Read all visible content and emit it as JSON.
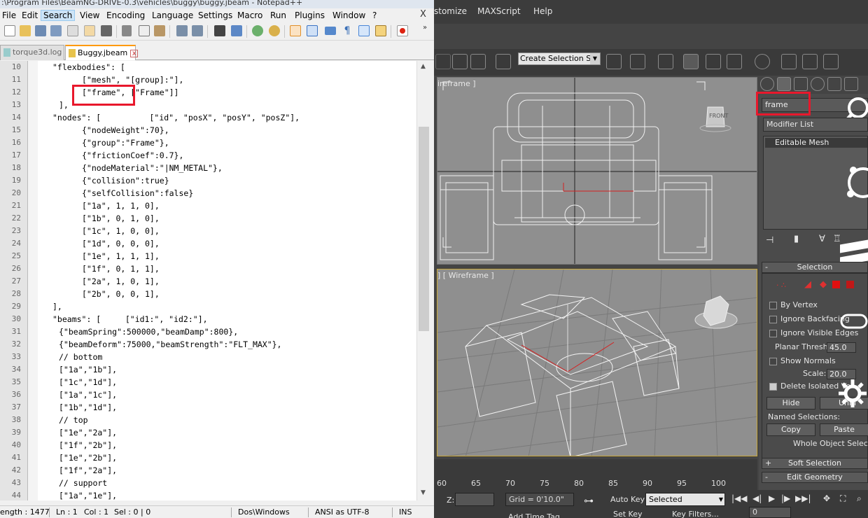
{
  "npp": {
    "title": ":\\Program Files\\BeamNG-DRIVE-0.3\\vehicles\\buggy\\buggy.jbeam - Notepad++",
    "menu": [
      "File",
      "Edit",
      "Search",
      "View",
      "Encoding",
      "Language",
      "Settings",
      "Macro",
      "Run",
      "Plugins",
      "Window",
      "?"
    ],
    "close_label": "X",
    "tabs": [
      {
        "label": "torque3d.log"
      },
      {
        "label": "Buggy.jbeam"
      }
    ],
    "lines": [
      {
        "n": "10",
        "text": "\"flexbodies\": ["
      },
      {
        "n": "11",
        "text": "[\"mesh\", \"[group]:\"],"
      },
      {
        "n": "12",
        "text": "[\"frame\", [\"Frame\"]]"
      },
      {
        "n": "13",
        "text": "],"
      },
      {
        "n": "14",
        "text": "\"nodes\": [          [\"id\", \"posX\", \"posY\", \"posZ\"],"
      },
      {
        "n": "15",
        "text": "{\"nodeWeight\":70},"
      },
      {
        "n": "16",
        "text": "{\"group\":\"Frame\"},"
      },
      {
        "n": "17",
        "text": "{\"frictionCoef\":0.7},"
      },
      {
        "n": "18",
        "text": "{\"nodeMaterial\":\"|NM_METAL\"},"
      },
      {
        "n": "19",
        "text": "{\"collision\":true}"
      },
      {
        "n": "20",
        "text": "{\"selfCollision\":false}"
      },
      {
        "n": "21",
        "text": "[\"1a\", 1, 1, 0],"
      },
      {
        "n": "22",
        "text": "[\"1b\", 0, 1, 0],"
      },
      {
        "n": "23",
        "text": "[\"1c\", 1, 0, 0],"
      },
      {
        "n": "24",
        "text": "[\"1d\", 0, 0, 0],"
      },
      {
        "n": "25",
        "text": "[\"1e\", 1, 1, 1],"
      },
      {
        "n": "26",
        "text": "[\"1f\", 0, 1, 1],"
      },
      {
        "n": "27",
        "text": "[\"2a\", 1, 0, 1],"
      },
      {
        "n": "28",
        "text": "[\"2b\", 0, 0, 1],"
      },
      {
        "n": "29",
        "text": "],"
      },
      {
        "n": "30",
        "text": "\"beams\": [     [\"id1:\", \"id2:\"],"
      },
      {
        "n": "31",
        "text": "{\"beamSpring\":500000,\"beamDamp\":800},"
      },
      {
        "n": "32",
        "text": "{\"beamDeform\":75000,\"beamStrength\":\"FLT_MAX\"},"
      },
      {
        "n": "33",
        "text": "// bottom"
      },
      {
        "n": "34",
        "text": "[\"1a\",\"1b\"],"
      },
      {
        "n": "35",
        "text": "[\"1c\",\"1d\"],"
      },
      {
        "n": "36",
        "text": "[\"1a\",\"1c\"],"
      },
      {
        "n": "37",
        "text": "[\"1b\",\"1d\"],"
      },
      {
        "n": "38",
        "text": "// top"
      },
      {
        "n": "39",
        "text": "[\"1e\",\"2a\"],"
      },
      {
        "n": "40",
        "text": "[\"1f\",\"2b\"],"
      },
      {
        "n": "41",
        "text": "[\"1e\",\"2b\"],"
      },
      {
        "n": "42",
        "text": "[\"1f\",\"2a\"],"
      },
      {
        "n": "43",
        "text": "// support"
      },
      {
        "n": "44",
        "text": "[\"1a\",\"1e\"],"
      }
    ],
    "status": {
      "length": "ength : 1477",
      "ln": "Ln : 1",
      "col": "Col : 1",
      "sel": "Sel : 0 | 0",
      "eol": "Dos\\Windows",
      "encoding": "ANSI as UTF-8",
      "mode": "INS"
    }
  },
  "max": {
    "menu": [
      "stomize",
      "MAXScript",
      "Help"
    ],
    "selection_set": "Create Selection Se",
    "vp_top_label": "ireframe ]",
    "vp_persp_label": "] [ Wireframe ]",
    "viewcube_label": "FRONT",
    "object_name": "frame",
    "modifier_list": "Modifier List",
    "stack_item": "Editable Mesh",
    "selection_rollout": {
      "title": "Selection",
      "by_vertex": "By Vertex",
      "ignore_backfacing": "Ignore Backfacing",
      "ignore_visible_edges": "Ignore Visible Edges",
      "planar_thresh_label": "Planar Thresh:",
      "planar_thresh": "45.0",
      "show_normals": "Show Normals",
      "scale_label": "Scale:",
      "scale": "20.0",
      "delete_isolated": "Delete Isolated Ve",
      "hide": "Hide",
      "unhide": "Unhi",
      "named_selections": "Named Selections:",
      "copy": "Copy",
      "paste": "Paste",
      "whole_object": "Whole Object Selected"
    },
    "soft_selection": "Soft Selection",
    "edit_geometry": "Edit Geometry",
    "timeline_ticks": [
      "60",
      "65",
      "70",
      "75",
      "80",
      "85",
      "90",
      "95",
      "100"
    ],
    "bottom": {
      "z_label": "Z:",
      "grid": "Grid = 0'10.0\"",
      "auto_key": "Auto Key",
      "selected": "Selected",
      "set_key": "Set Key",
      "key_filters": "Key Filters...",
      "add_time_tag": "Add Time Tag",
      "frame": "0"
    }
  }
}
